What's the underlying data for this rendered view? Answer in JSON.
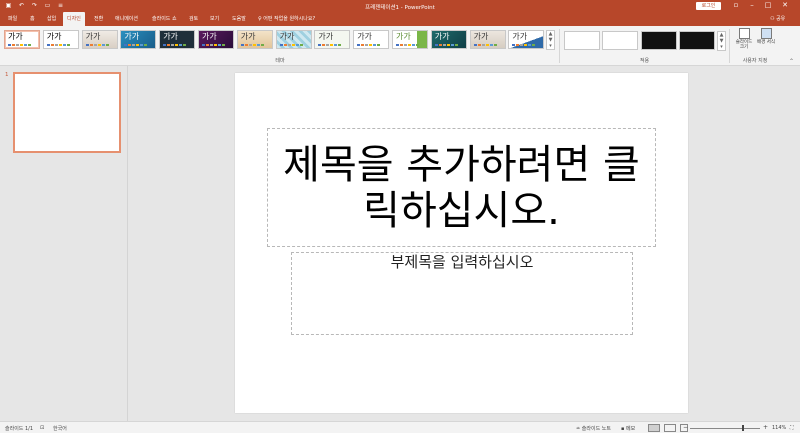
{
  "titlebar": {
    "title": "프레젠테이션1 - PowerPoint",
    "login": "로그인",
    "qat_icons": [
      "save-icon",
      "undo-icon",
      "redo-icon",
      "start-from-beginning-icon",
      "customize-qat-icon"
    ]
  },
  "tabs": [
    {
      "label": "파일",
      "active": false
    },
    {
      "label": "홈",
      "active": false
    },
    {
      "label": "삽입",
      "active": false
    },
    {
      "label": "디자인",
      "active": true
    },
    {
      "label": "전환",
      "active": false
    },
    {
      "label": "애니메이션",
      "active": false
    },
    {
      "label": "슬라이드 쇼",
      "active": false
    },
    {
      "label": "검토",
      "active": false
    },
    {
      "label": "보기",
      "active": false
    },
    {
      "label": "도움말",
      "active": false
    }
  ],
  "tell_me": "어떤 작업을 원하시나요?",
  "share": "공유",
  "ribbon": {
    "theme_thumb_text": "가가",
    "themes_group": "테마",
    "variants_group": "적용",
    "customize_group": "사용자 지정",
    "slide_size_label": "슬라이드 크기",
    "format_background_label": "배경 서식",
    "accent": "#b7472a"
  },
  "thumbnail": {
    "number": "1"
  },
  "slide": {
    "title_placeholder": "제목을 추가하려면 클릭하십시오.",
    "subtitle_placeholder": "부제목을 입력하십시오"
  },
  "status": {
    "slide_counter": "슬라이드 1/1",
    "language": "한국어",
    "notes": "슬라이드 노트",
    "comments": "메모",
    "zoom": "114%"
  }
}
